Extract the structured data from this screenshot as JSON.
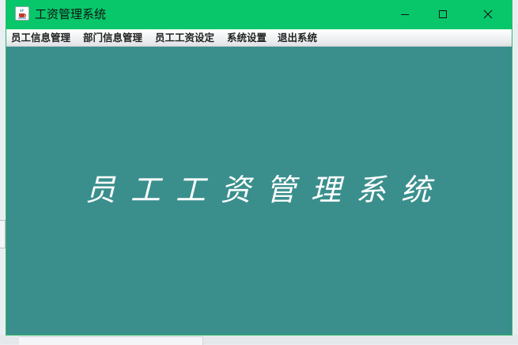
{
  "window": {
    "title": "工资管理系统",
    "app_icon": "java-cup-icon",
    "controls": {
      "minimize_icon": "minimize-icon",
      "maximize_icon": "maximize-icon",
      "close_icon": "close-icon"
    },
    "titlebar_color": "#07c76a"
  },
  "menubar": {
    "items": [
      {
        "label": "员工信息管理"
      },
      {
        "label": "部门信息管理"
      },
      {
        "label": "员工工资设定"
      },
      {
        "label": "系统设置"
      },
      {
        "label": "退出系统"
      }
    ]
  },
  "main": {
    "banner_text": "员工工资管理系统",
    "background_color": "#3a8f8d"
  }
}
